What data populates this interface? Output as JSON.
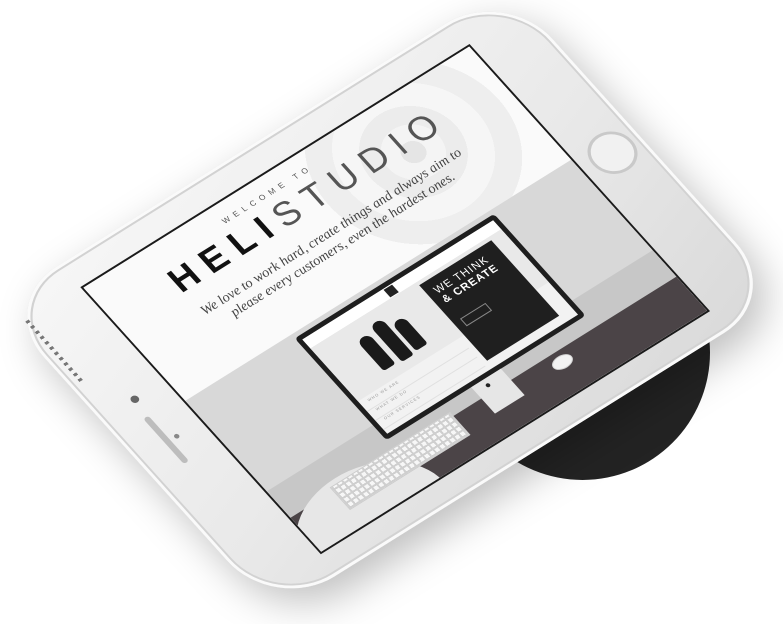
{
  "screen": {
    "welcome": "WELCOME TO",
    "brand_bold": "HELI",
    "brand_light": "STUDIO",
    "tagline": "We love to work hard, create things and always aim to please every customers, even the hardest ones."
  },
  "monitor_preview": {
    "card_title_thin": "WE THINK",
    "card_title_bold": "& CREATE",
    "feature_1": "WHO WE ARE",
    "feature_2": "WHAT WE DO",
    "feature_3": "OUR SERVICES"
  },
  "colors": {
    "disc": "#232323",
    "phone_body": "#eeeeee",
    "screen_border": "#1b1b1b"
  },
  "icons": [
    "apple-logo-icon",
    "home-button-icon",
    "front-camera-icon"
  ]
}
